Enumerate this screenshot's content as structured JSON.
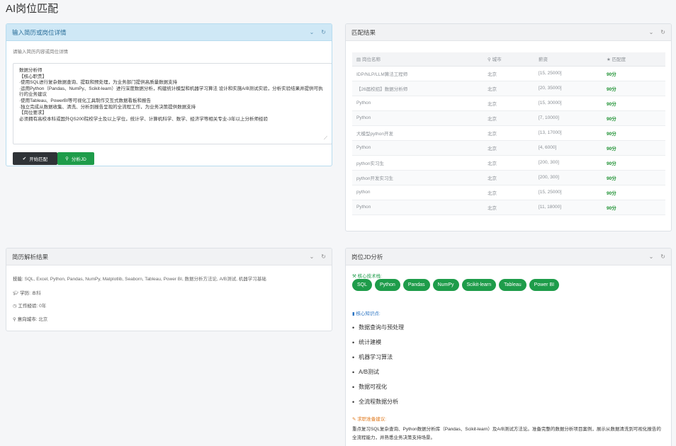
{
  "page": {
    "title": "AI岗位匹配"
  },
  "input_panel": {
    "title": "输入简历或岗位详情",
    "label": "请输入简历内容或岗位详情",
    "text": "数据分析师\n【核心职责】\n·使用SQL进行复杂数据查询、提取和预处理，为业务部门提供高质量数据支持\n·运用Python（Pandas、NumPy、Scikit-learn）进行深度数据分析，构建统计模型和机器学习算法 设计和实施A/B测试实验，分析实验结果并提供可执行的业务建议\n·使用Tableau、PowerBI等可视化工具制作交互式数据看板和报告\n·独立完成从数据收集、清洗、分析到报告呈现的全流程工作，为业务决策提供数据支持\n【岗位要求】\n必须拥有高校本科或国外QS200院校学士及以上学位，统计学、计算机科学、数学、经济学等相关专业-3年以上分析师经验",
    "start_button": "开始匹配",
    "analyze_button": "分析JD"
  },
  "match_panel": {
    "title": "匹配结果",
    "columns": [
      "岗位名称",
      "城市",
      "薪资",
      "匹配度"
    ],
    "rows": [
      [
        "IDP/NLP/LLM算法工程师",
        "北京",
        "[15, 25000]",
        "90分"
      ],
      [
        "【26届校招】数据分析师",
        "北京",
        "[20, 35000]",
        "90分"
      ],
      [
        "Python",
        "北京",
        "[15, 30000]",
        "90分"
      ],
      [
        "Python",
        "北京",
        "[7, 10000]",
        "90分"
      ],
      [
        "大模型python开发",
        "北京",
        "[13, 17000]",
        "90分"
      ],
      [
        "Python",
        "北京",
        "[4, 6000]",
        "90分"
      ],
      [
        "python实习生",
        "北京",
        "[200, 300]",
        "90分"
      ],
      [
        "python开发实习生",
        "北京",
        "[200, 300]",
        "90分"
      ],
      [
        "python",
        "北京",
        "[15, 25000]",
        "90分"
      ],
      [
        "Python",
        "北京",
        "[11, 18000]",
        "90分"
      ]
    ]
  },
  "resume_panel": {
    "title": "简历解析结果",
    "skills_label": "技能:",
    "skills": "SQL, Excel, Python, Pandas, NumPy, Matplotlib, Seaborn, Tableau, Power BI, 数据分析方法论, A/B测试, 机器学习基础",
    "education_label": "学历:",
    "education": "本科",
    "experience_label": "工作经验:",
    "experience": "0年",
    "city_label": "意向城市:",
    "city": "北京"
  },
  "jd_panel": {
    "title": "岗位JD分析",
    "tech_title": "核心技术栈:",
    "tech": [
      "SQL",
      "Python",
      "Pandas",
      "NumPy",
      "Scikit-learn",
      "Tableau",
      "Power BI"
    ],
    "knowledge_title": "核心知识点:",
    "knowledge": [
      "数据查询与预处理",
      "统计建模",
      "机器学习算法",
      "A/B测试",
      "数据可视化",
      "全流程数据分析"
    ],
    "advice_title": "求职准备建议:",
    "advice": "重点复习SQL复杂查询、Python数据分析库（Pandas、Scikit-learn）及A/B测试方法论。准备完整的数据分析项目案例，展示从数据清洗到可视化报告的全流程能力，并熟悉业务决策支持场景。"
  }
}
